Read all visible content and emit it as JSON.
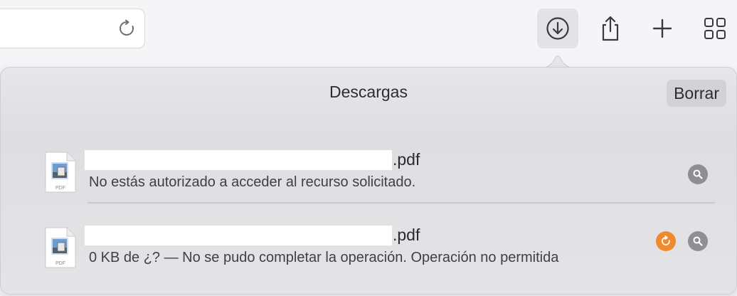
{
  "toolbar": {
    "reload_icon": "arrow-clockwise-icon",
    "downloads_icon": "arrow-down-circle-icon",
    "share_icon": "square-and-arrow-up-icon",
    "new_tab_icon": "plus-icon",
    "tab_overview_icon": "square-grid-icon"
  },
  "downloads": {
    "title": "Descargas",
    "clear_label": "Borrar",
    "items": [
      {
        "file_type": "PDF",
        "extension": ".pdf",
        "status": "No estás autorizado a acceder al recurso solicitado.",
        "actions": [
          "magnifying-glass-icon"
        ]
      },
      {
        "file_type": "PDF",
        "extension": ".pdf",
        "status": "0 KB de ¿? — No se pudo completar la operación. Operación no permitida",
        "actions": [
          "retry-icon",
          "magnifying-glass-icon"
        ]
      }
    ]
  },
  "colors": {
    "accent_retry": "#f08a2c",
    "reveal_button": "#8e8e93",
    "popover_bg": "#e4e4e7"
  }
}
